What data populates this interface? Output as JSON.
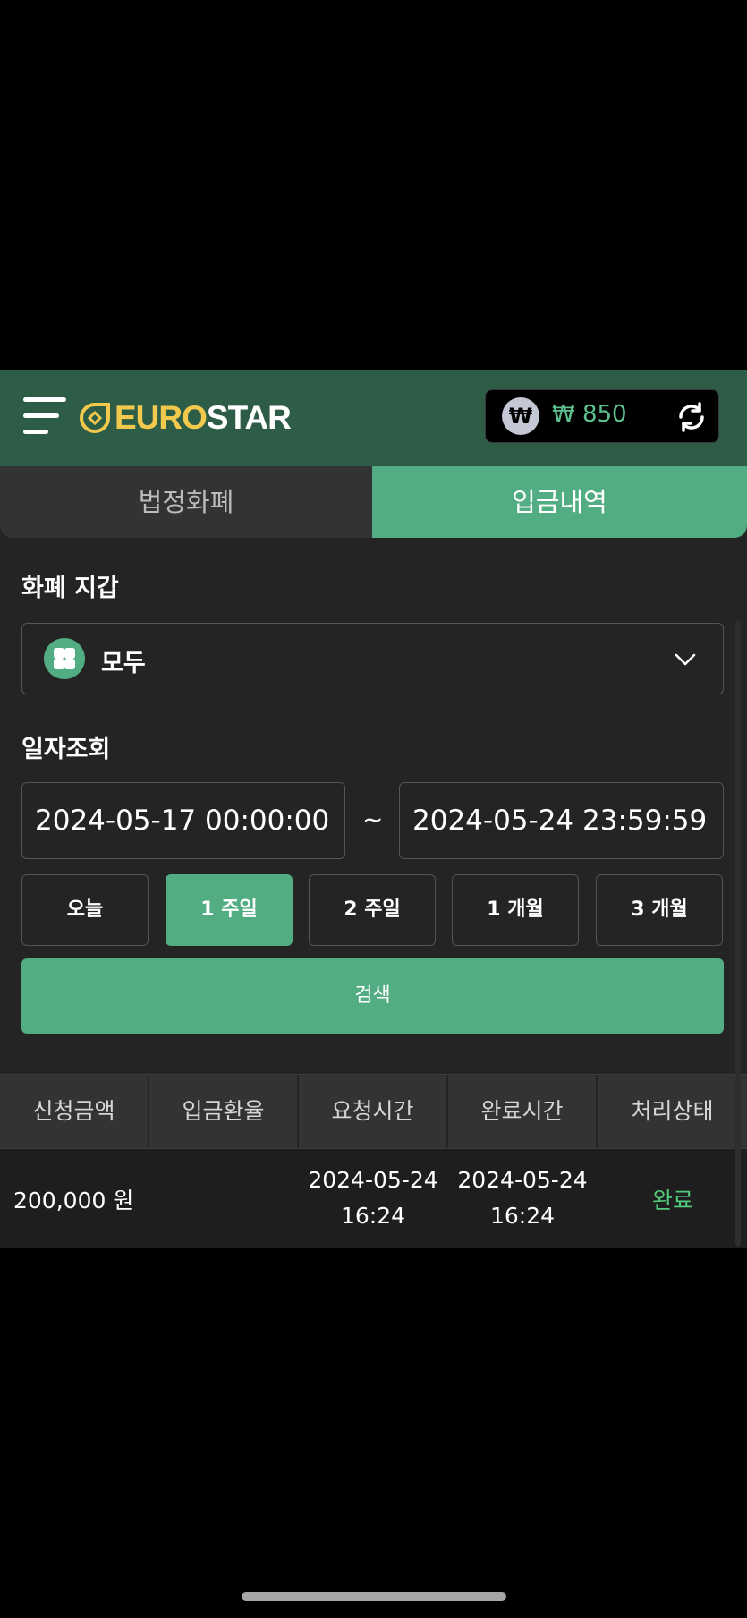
{
  "header": {
    "menu_icon": "hamburger-menu-icon",
    "logo_part1": "EURO",
    "logo_part2": "STAR",
    "wallet": {
      "currency_symbol": "₩",
      "amount": "₩ 850",
      "refresh_icon": "refresh-icon"
    }
  },
  "tabs": [
    {
      "label": "법정화폐",
      "active": false
    },
    {
      "label": "입금내역",
      "active": true
    }
  ],
  "filters": {
    "wallet_label": "화폐 지갑",
    "wallet_value": "모두",
    "date_label": "일자조회",
    "start_date": "2024-05-17 00:00:00",
    "separator": "~",
    "end_date": "2024-05-24 23:59:59",
    "periods": [
      "오늘",
      "1 주일",
      "2 주일",
      "1 개월",
      "3 개월"
    ],
    "selected_period": "1 주일",
    "search_label": "검색"
  },
  "table": {
    "columns": [
      "신청금액",
      "입금환율",
      "요청시간",
      "완료시간",
      "처리상태"
    ],
    "rows": [
      {
        "amount": "200,000 원",
        "rate": "",
        "request_date": "2024-05-24",
        "request_time": "16:24",
        "complete_date": "2024-05-24",
        "complete_time": "16:24",
        "status": "완료"
      }
    ]
  },
  "colors": {
    "accent": "#52ad82",
    "header_bg": "#2d5d47",
    "logo_yellow": "#f2c94c",
    "status_done": "#52c97a"
  }
}
